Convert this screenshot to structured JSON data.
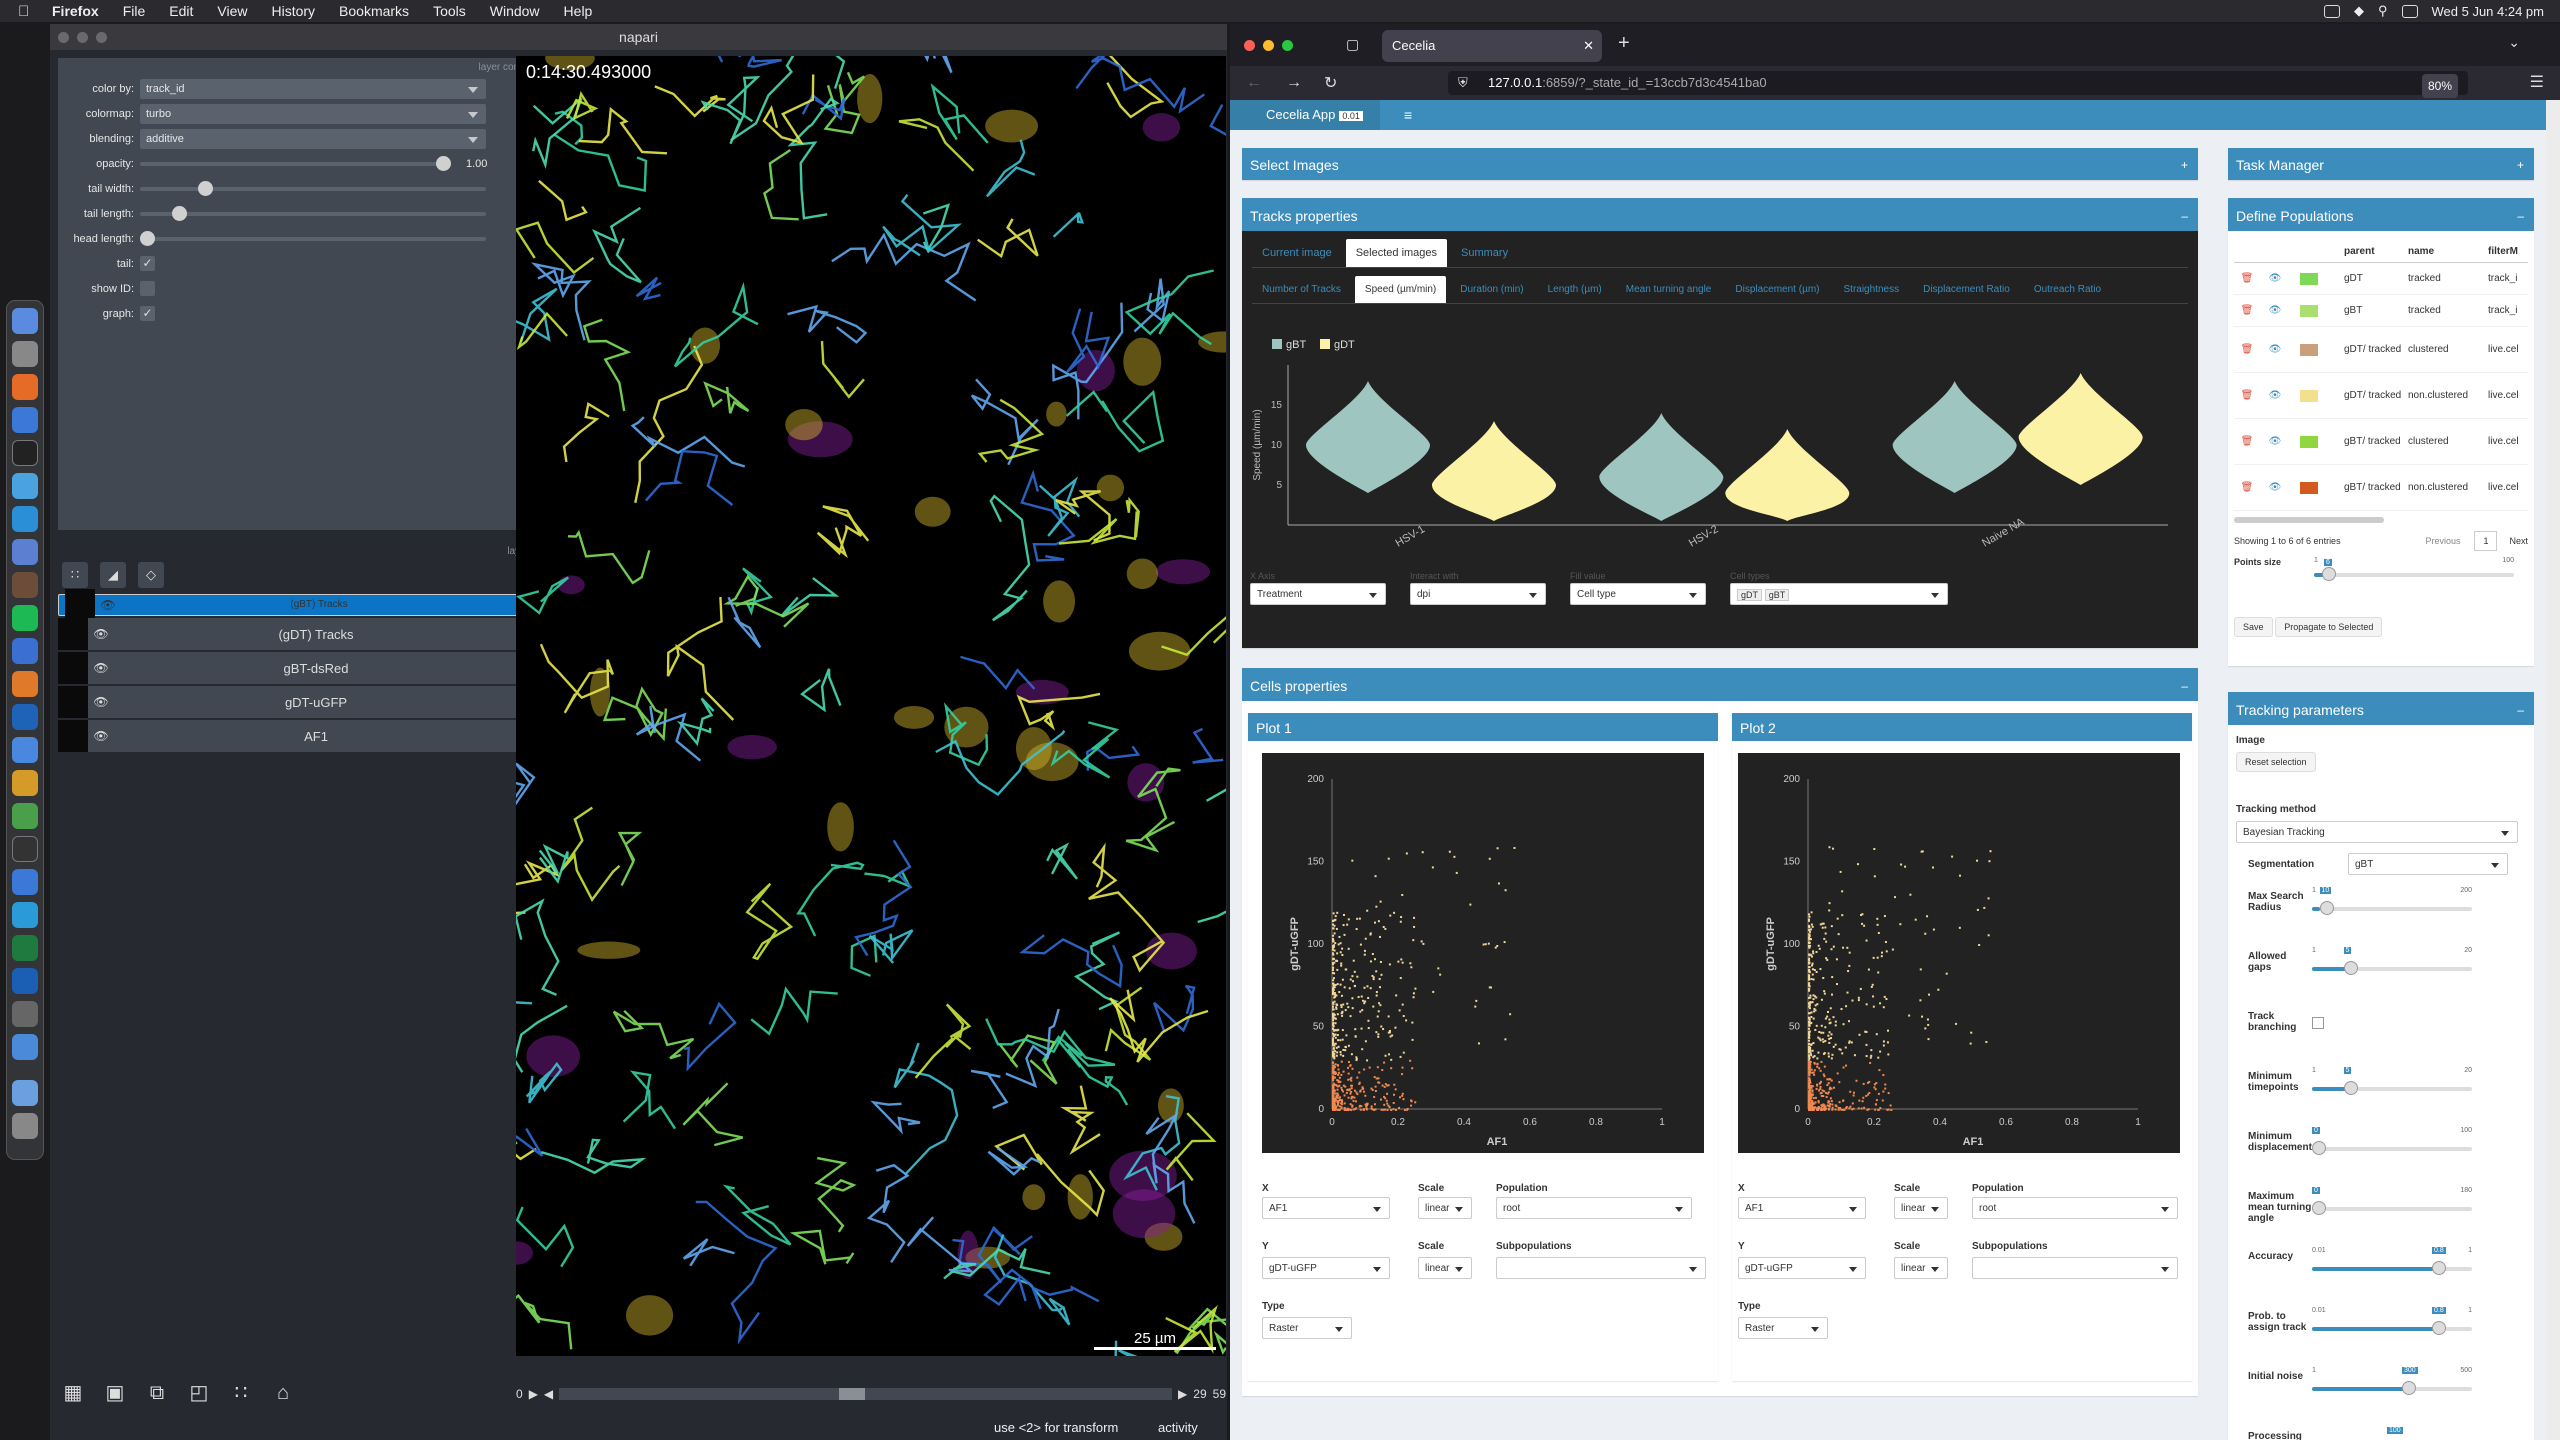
{
  "menubar": {
    "app": "Firefox",
    "items": [
      "File",
      "Edit",
      "View",
      "History",
      "Bookmarks",
      "Tools",
      "Window",
      "Help"
    ],
    "clock": "Wed 5 Jun  4:24 pm"
  },
  "napari": {
    "title": "napari",
    "layer_controls_label": "layer controls",
    "layer_list_label": "layer list",
    "controls": {
      "color_by_label": "color by:",
      "color_by_value": "track_id",
      "colormap_label": "colormap:",
      "colormap_value": "turbo",
      "blending_label": "blending:",
      "blending_value": "additive",
      "opacity_label": "opacity:",
      "opacity_value": "1.00",
      "tail_width_label": "tail width:",
      "tail_length_label": "tail length:",
      "head_length_label": "head length:",
      "tail_label": "tail:",
      "show_id_label": "show ID:",
      "graph_label": "graph:"
    },
    "layers": [
      {
        "name": "(gBT) Tracks",
        "selected": true
      },
      {
        "name": "(gDT) Tracks",
        "selected": false
      },
      {
        "name": "gBT-dsRed",
        "selected": false
      },
      {
        "name": "gDT-uGFP",
        "selected": false
      },
      {
        "name": "AF1",
        "selected": false
      }
    ],
    "timestamp": "0:14:30.493000",
    "scalebar": "25 µm",
    "frame_start": "0",
    "frame_current": "29",
    "frame_max": "59",
    "status_hint": "use <2> for transform",
    "activity": "activity"
  },
  "firefox": {
    "tab_title": "Cecelia",
    "url_host": "127.0.0.1",
    "url_rest": ":6859/?_state_id_=13ccb7d3c4541ba0",
    "zoom": "80%"
  },
  "cecelia": {
    "app_title": "Cecelia App",
    "version": "0.01",
    "select_images": "Select Images",
    "task_manager": "Task Manager",
    "tracks_properties": "Tracks properties",
    "tracks_tabs": [
      "Current image",
      "Selected images",
      "Summary"
    ],
    "metric_tabs": [
      "Number of Tracks",
      "Speed (µm/min)",
      "Duration (min)",
      "Length (µm)",
      "Mean turning angle",
      "Displacement (µm)",
      "Straightness",
      "Displacement Ratio",
      "Outreach Ratio"
    ],
    "x_axis_label": "X Axis",
    "x_axis_value": "Treatment",
    "interact_label": "Interact with",
    "interact_value": "dpi",
    "fill_label": "Fill value",
    "fill_value": "Cell type",
    "cell_types_label": "Cell types",
    "cell_types": [
      "gDT",
      "gBT"
    ],
    "cells_properties": "Cells properties",
    "plot1_title": "Plot 1",
    "plot2_title": "Plot 2",
    "x_label": "X",
    "y_label": "Y",
    "scale_label": "Scale",
    "type_label": "Type",
    "population_label": "Population",
    "subpopulations_label": "Subpopulations",
    "plot_x_value": "AF1",
    "plot_y_value": "gDT-uGFP",
    "scale_value": "linear",
    "population_value": "root",
    "type_value": "Raster",
    "define_populations": "Define Populations",
    "pop_headers": [
      "parent",
      "name",
      "filterM"
    ],
    "populations": [
      {
        "parent": "gDT",
        "name": "tracked",
        "filter": "track_i",
        "color": "#7ed957"
      },
      {
        "parent": "gBT",
        "name": "tracked",
        "filter": "track_i",
        "color": "#a8e06f"
      },
      {
        "parent": "gDT/ tracked",
        "name": "clustered",
        "filter": "live.cel",
        "color": "#c8a07a"
      },
      {
        "parent": "gDT/ tracked",
        "name": "non.clustered",
        "filter": "live.cel",
        "color": "#f2e08c"
      },
      {
        "parent": "gBT/ tracked",
        "name": "clustered",
        "filter": "live.cel",
        "color": "#8fd63f"
      },
      {
        "parent": "gBT/ tracked",
        "name": "non.clustered",
        "filter": "live.cel",
        "color": "#d35a1e"
      }
    ],
    "entries_text": "Showing 1 to 6 of 6 entries",
    "prev": "Previous",
    "page": "1",
    "next": "Next",
    "points_size_label": "Points size",
    "points_size_min": "1",
    "points_size_value": "6",
    "points_size_max": "100",
    "save": "Save",
    "propagate": "Propagate to Selected",
    "tracking_parameters": "Tracking parameters",
    "image_label": "Image",
    "reset_selection": "Reset selection",
    "tracking_method_label": "Tracking method",
    "tracking_method": "Bayesian Tracking",
    "segmentation_label": "Segmentation",
    "segmentation_value": "gBT",
    "params": [
      {
        "label": "Max Search Radius",
        "min": "1",
        "value": "10",
        "max": "200",
        "frac": 0.05
      },
      {
        "label": "Allowed gaps",
        "min": "1",
        "value": "5",
        "max": "20",
        "frac": 0.21
      },
      {
        "label": "Track branching",
        "checkbox": true
      },
      {
        "label": "Minimum timepoints",
        "min": "1",
        "value": "5",
        "max": "20",
        "frac": 0.21
      },
      {
        "label": "Minimum displacement",
        "min": "",
        "value": "0",
        "max": "100",
        "frac": 0.0
      },
      {
        "label": "Maximum mean turning angle",
        "min": "",
        "value": "0",
        "max": "180",
        "frac": 0.0
      },
      {
        "label": "Accuracy",
        "min": "0.01",
        "value": "0.8",
        "max": "1",
        "frac": 0.8
      },
      {
        "label": "Prob. to assign track",
        "min": "0.01",
        "value": "0.8",
        "max": "1",
        "frac": 0.8
      },
      {
        "label": "Initial noise",
        "min": "1",
        "value": "300",
        "max": "500",
        "frac": 0.6
      },
      {
        "label": "Processing",
        "min": "",
        "value": "100",
        "max": "",
        "frac": 0.5
      }
    ]
  },
  "chart_data": [
    {
      "type": "violin",
      "title": "",
      "ylabel": "Speed (µm/min)",
      "categories": [
        "HSV-1",
        "HSV-2",
        "Naive NA"
      ],
      "series": [
        {
          "name": "gBT",
          "color": "#9fc5c0",
          "median": [
            10,
            6,
            10
          ]
        },
        {
          "name": "gDT",
          "color": "#fcf2a6",
          "median": [
            5,
            4,
            11
          ]
        }
      ],
      "yticks": [
        5,
        10,
        15
      ]
    },
    {
      "type": "scatter",
      "title": "Plot 1",
      "xlabel": "AF1",
      "ylabel": "gDT-uGFP",
      "xlim": [
        0,
        1
      ],
      "ylim": [
        0,
        200
      ],
      "xticks": [
        0,
        0.2,
        0.4,
        0.6,
        0.8,
        1
      ],
      "yticks": [
        0,
        50,
        100,
        150,
        200
      ]
    },
    {
      "type": "scatter",
      "title": "Plot 2",
      "xlabel": "AF1",
      "ylabel": "gDT-uGFP",
      "xlim": [
        0,
        1
      ],
      "ylim": [
        0,
        200
      ],
      "xticks": [
        0,
        0.2,
        0.4,
        0.6,
        0.8,
        1
      ],
      "yticks": [
        0,
        50,
        100,
        150,
        200
      ]
    }
  ]
}
